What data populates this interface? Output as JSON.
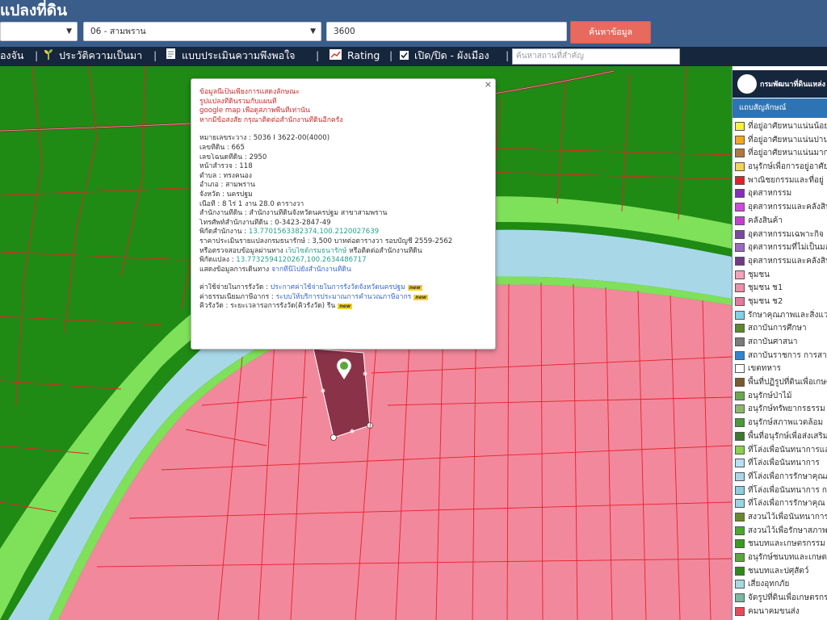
{
  "header": {
    "title": "แปลงที่ดิน",
    "province_select": "",
    "district_select": "06 - สามพราน",
    "parcel_input": "3600",
    "search_button": "ค้นหาข้อมูล"
  },
  "toolbar": {
    "item1": "องจัน",
    "item2": "ประวัติความเป็นมา",
    "item3": "แบบประเมินความพึงพอใจ",
    "item4": "Rating",
    "item5": "เปิด/ปิด - ผังเมือง",
    "place_search_placeholder": "ค้นหาสถานที่สำคัญ",
    "sep": "|"
  },
  "popup": {
    "close": "×",
    "disclaimer": [
      "ข้อมูลนี้เป็นเพียงการแสดงลักษณะ",
      "รูปแปลงที่ดินรวมกับแผนที่",
      "google map เพื่อดูสภาพพื้นที่เท่านั้น",
      "หากมีข้อสงสัย กรุณาติดต่อสำนักงานที่ดินอีกครั้ง"
    ],
    "details": [
      "หมายเลขระวาง : 5036 I 3622-00(4000)",
      "เลขที่ดิน : 665",
      "เลขโฉนดที่ดิน : 2950",
      "หน้าสำรวจ : 118",
      "ตำบล : ทรงคนอง",
      "อำเภอ : สามพราน",
      "จังหวัด : นครปฐม",
      "เนื้อที่ : 8 ไร่ 1 งาน 28.0 ตารางวา",
      "สำนักงานที่ดิน : สำนักงานที่ดินจังหวัดนครปฐม สาขาสามพราน",
      "โทรศัพท์สำนักงานที่ดิน : 0-3423-2847-49"
    ],
    "office_coord_label": "พิกัดสำนักงาน : ",
    "office_coord_value": "13.7701563382374,100.2120027639",
    "appraisal": "ราคาประเมินรายแปลงกรมธนารักษ์ : 3,500 บาทต่อตารางวา รอบบัญชี 2559-2562",
    "verify_prefix": "หรือตรวจสอบข้อมูลผ่านทาง ",
    "verify_link": "เว็บไซต์กรมธนารักษ์",
    "verify_suffix": " หรือติดต่อสำนักงานที่ดิน",
    "parcel_coord_label": "พิกัดแปลง : ",
    "parcel_coord_value": "13.7732594120267,100.2634486717",
    "route_prefix": "แสดงข้อมูลการเดินทาง ",
    "route_link": "จากที่นี่ไปยังสำนักงานที่ดิน",
    "fee_prefix": "ค่าใช้จ่ายในการรังวัด : ",
    "fee_link": "ประกาศค่าใช้จ่ายในการรังวัดจังหวัดนครปฐม",
    "queue_prefix": "ค่าธรรมเนียมภาษีอากร : ",
    "queue_link": "ระบบให้บริการประมาณการคำนวณภาษีอากร",
    "survey_text": "คิวรังวัด : ระยะเวลารอการรังวัด(คิวรังวัด) รีน",
    "new_badge": "new"
  },
  "legend": {
    "org": "กรมพัฒนาที่ดินแหล่ง",
    "subtitle": "แถบสัญลักษณ์",
    "items": [
      {
        "label": "ที่อยู่อาศัยหนาแน่นน้อย",
        "color": "#f6f23a"
      },
      {
        "label": "ที่อยู่อาศัยหนาแน่นปาน",
        "color": "#f5a623"
      },
      {
        "label": "ที่อยู่อาศัยหนาแน่นมาก",
        "color": "#b07a3a"
      },
      {
        "label": "อนุรักษ์เพื่อการอยู่อาศัย",
        "color": "#f2d64a"
      },
      {
        "label": "พาณิชยกรรมและที่อยู่",
        "color": "#e0222a"
      },
      {
        "label": "อุตสาหกรรม",
        "color": "#8a2bbf"
      },
      {
        "label": "อุตสาหกรรมและคลังสินค้า",
        "color": "#d24bd8"
      },
      {
        "label": "คลังสินค้า",
        "color": "#c43fd0"
      },
      {
        "label": "อุตสาหกรรมเฉพาะกิจ",
        "color": "#7a4aa0"
      },
      {
        "label": "อุตสาหกรรมที่ไม่เป็นมลพิษ",
        "color": "#9b6ac0"
      },
      {
        "label": "อุตสาหกรรมและคลังสินค้า",
        "color": "#6e3a8a"
      },
      {
        "label": "ชุมชน",
        "color": "#f3a3b8"
      },
      {
        "label": "ชุมชน ช1",
        "color": "#ee8fa8"
      },
      {
        "label": "ชุมชน ช2",
        "color": "#e47a98"
      },
      {
        "label": "รักษาคุณภาพและสิ่งแวดล้อม",
        "color": "#7fd3e6"
      },
      {
        "label": "สถาบันการศึกษา",
        "color": "#5a8a2a"
      },
      {
        "label": "สถาบันศาสนา",
        "color": "#7a7a7a"
      },
      {
        "label": "สถาบันราชการ การสา",
        "color": "#2e86d1"
      },
      {
        "label": "เขตทหาร",
        "color": "#ffffff"
      },
      {
        "label": "พื้นที่ปฏิรูปที่ดินเพื่อเกษตร",
        "color": "#7a5a2a"
      },
      {
        "label": "อนุรักษ์ป่าไม้",
        "color": "#6aa84f"
      },
      {
        "label": "อนุรักษ์ทรัพยากรธรรม",
        "color": "#8ab86a"
      },
      {
        "label": "อนุรักษ์สภาพแวดล้อม",
        "color": "#4a9a3a"
      },
      {
        "label": "พื้นที่อนุรักษ์เพื่อส่งเสริม",
        "color": "#3a7a2a"
      },
      {
        "label": "ที่โล่งเพื่อนันทนาการและ",
        "color": "#8ad04a"
      },
      {
        "label": "ที่โล่งเพื่อนันทนาการ",
        "color": "#b8e0f0"
      },
      {
        "label": "ที่โล่งเพื่อการรักษาคุณภาพ",
        "color": "#a8d8e8"
      },
      {
        "label": "ที่โล่งเพื่อนันทนาการ ก",
        "color": "#8ccde0"
      },
      {
        "label": "ที่โล่งเพื่อการรักษาคุณ",
        "color": "#9ad4e4"
      },
      {
        "label": "สงวนไว้เพื่อนันทนาการ",
        "color": "#6a8a2a"
      },
      {
        "label": "สงวนไว้เพื่อรักษาสภาพ",
        "color": "#4aa82a"
      },
      {
        "label": "ชนบทและเกษตรกรรม",
        "color": "#3a9a1a"
      },
      {
        "label": "อนุรักษ์ชนบทและเกษตร",
        "color": "#5aa83a"
      },
      {
        "label": "ชนบทและปศุสัตว์",
        "color": "#2e8a1a"
      },
      {
        "label": "เสี่ยงอุทกภัย",
        "color": "#a8d8e0"
      },
      {
        "label": "จัดรูปที่ดินเพื่อเกษตรกรรม",
        "color": "#7ab8a0"
      },
      {
        "label": "คมนาคมขนส่ง",
        "color": "#e84a5a"
      }
    ]
  }
}
